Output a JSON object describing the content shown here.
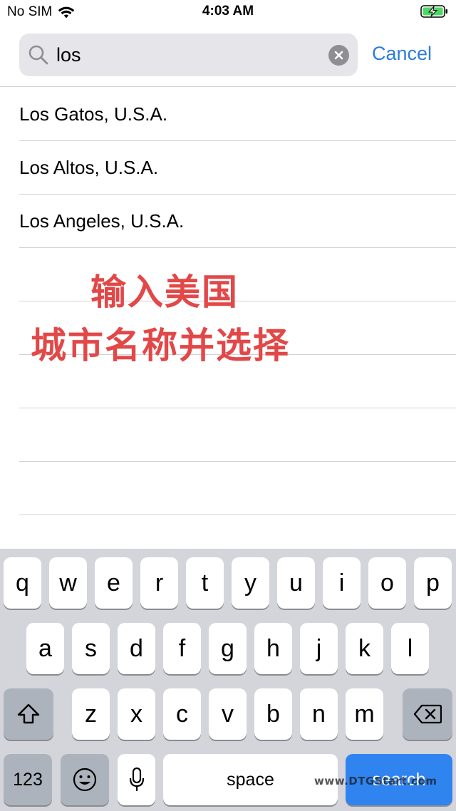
{
  "status_bar": {
    "carrier": "No SIM",
    "time": "4:03 AM"
  },
  "search": {
    "value": "los",
    "cancel_label": "Cancel"
  },
  "results": [
    "Los Gatos, U.S.A.",
    "Los Altos, U.S.A.",
    "Los Angeles, U.S.A."
  ],
  "annotation": {
    "line1": "输入美国",
    "line2": "城市名称并选择",
    "color": "#e24848"
  },
  "keyboard": {
    "row1": [
      "q",
      "w",
      "e",
      "r",
      "t",
      "y",
      "u",
      "i",
      "o",
      "p"
    ],
    "row2": [
      "a",
      "s",
      "d",
      "f",
      "g",
      "h",
      "j",
      "k",
      "l"
    ],
    "row3": [
      "z",
      "x",
      "c",
      "v",
      "b",
      "n",
      "m"
    ],
    "numbers_label": "123",
    "space_label": "space",
    "search_label": "search"
  },
  "watermark": "www.DTGStart.com",
  "colors": {
    "accent": "#2d7cd8",
    "search_key": "#2f84f0",
    "keyboard_bg": "#d3d5db"
  }
}
